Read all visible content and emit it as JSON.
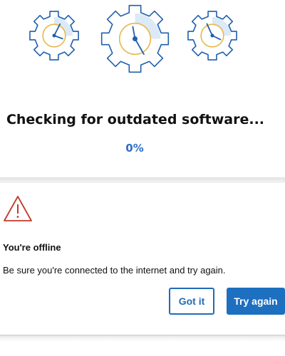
{
  "scan": {
    "title": "Checking for outdated software...",
    "progress_text": "0%",
    "progress_value": 0
  },
  "icons": {
    "gears": [
      "gear-clock-icon",
      "gear-clock-icon",
      "gear-clock-icon"
    ],
    "warning": "warning-triangle-icon"
  },
  "dialog": {
    "title": "You're offline",
    "message": "Be sure you're connected to the internet and try again.",
    "buttons": {
      "dismiss_label": "Got it",
      "retry_label": "Try again"
    }
  },
  "colors": {
    "accent": "#1d6fc0",
    "progress": "#2f6fc4",
    "gear_outline": "#1e5fae",
    "gear_fill": "#dce9f7",
    "clock_ring": "#e6b94a",
    "warning": "#c0392b"
  }
}
